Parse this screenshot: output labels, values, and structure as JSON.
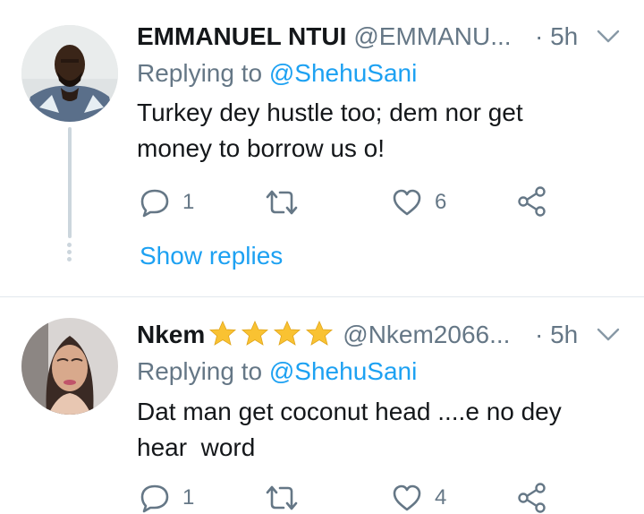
{
  "tweets": [
    {
      "name": "EMMANUEL NTUI",
      "handle": "@EMMANU...",
      "time": "· 5h",
      "replying_label": "Replying to",
      "replying_handle": "@ShehuSani",
      "text": "Turkey dey hustle too; dem nor get\nmoney to borrow us o!",
      "reply_count": "1",
      "retweet_count": "",
      "like_count": "6",
      "show_replies_label": "Show replies"
    },
    {
      "name": "Nkem",
      "name_emoji": "★★★★",
      "handle": "@Nkem2066...",
      "time": "· 5h",
      "replying_label": "Replying to",
      "replying_handle": "@ShehuSani",
      "text": "Dat man get coconut head ....e no dey\nhear  word",
      "reply_count": "1",
      "retweet_count": "",
      "like_count": "4"
    }
  ],
  "icons": {
    "reply": "reply-icon",
    "retweet": "retweet-icon",
    "like": "heart-icon",
    "share": "share-icon",
    "more": "chevron-down-icon"
  },
  "colors": {
    "accent": "#1da1f2",
    "secondary_text": "#657786",
    "primary_text": "#14171a",
    "star": "#f9c232",
    "divider": "#e1e8ed"
  }
}
